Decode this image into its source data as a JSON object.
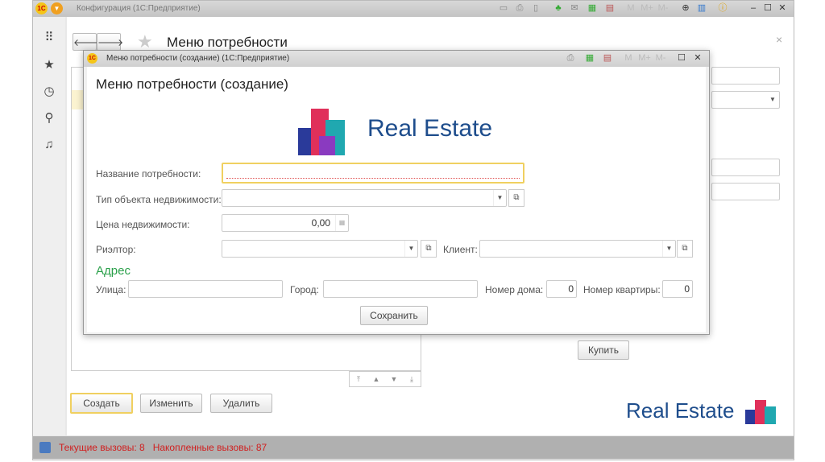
{
  "app": {
    "title": "Конфигурация  (1С:Предприятие)",
    "logo": "1С"
  },
  "page": {
    "title": "Меню потребности",
    "close": "×"
  },
  "modal": {
    "window_title": "Меню потребности (создание)  (1С:Предприятие)",
    "heading": "Меню потребности (создание)",
    "brand": "Real Estate",
    "fields": {
      "name_label": "Название потребности:",
      "name_value": "",
      "type_label": "Тип объекта недвижимости:",
      "price_label": "Цена недвижимости:",
      "price_value": "0,00",
      "realtor_label": "Риэлтор:",
      "client_label": "Клиент:"
    },
    "address": {
      "heading": "Адрес",
      "street_label": "Улица:",
      "city_label": "Город:",
      "house_label": "Номер дома:",
      "house_value": "0",
      "apt_label": "Номер квартиры:",
      "apt_value": "0"
    },
    "save_label": "Сохранить",
    "toolbar": [
      "M",
      "M+",
      "M-"
    ]
  },
  "main": {
    "buy_label": "Купить",
    "create_label": "Создать",
    "edit_label": "Изменить",
    "delete_label": "Удалить",
    "brand": "Real Estate"
  },
  "status": {
    "current": "Текущие вызовы: 8",
    "accumulated": "Накопленные вызовы: 87"
  },
  "titlebar_mem": [
    "M",
    "M+",
    "M-"
  ]
}
